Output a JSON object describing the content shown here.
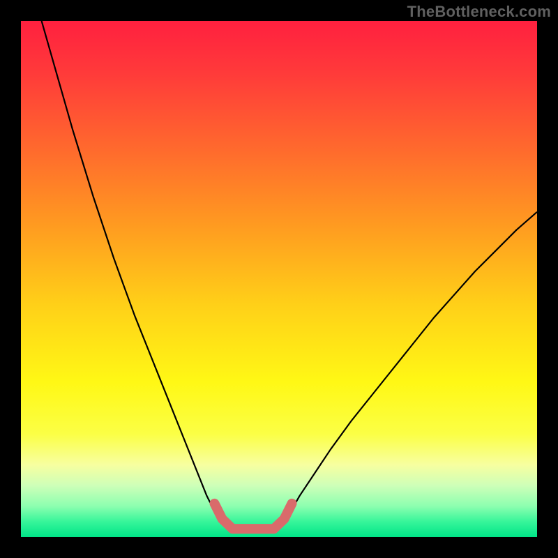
{
  "watermark": "TheBottleneck.com",
  "chart_data": {
    "type": "line",
    "title": "",
    "xlabel": "",
    "ylabel": "",
    "xlim": [
      0,
      100
    ],
    "ylim": [
      0,
      100
    ],
    "grid": false,
    "legend": false,
    "background_gradient": {
      "stops": [
        {
          "offset": 0.0,
          "color": "#ff203f"
        },
        {
          "offset": 0.1,
          "color": "#ff3a3a"
        },
        {
          "offset": 0.25,
          "color": "#ff6a2d"
        },
        {
          "offset": 0.4,
          "color": "#ff9c20"
        },
        {
          "offset": 0.55,
          "color": "#ffd018"
        },
        {
          "offset": 0.7,
          "color": "#fff815"
        },
        {
          "offset": 0.8,
          "color": "#fbff45"
        },
        {
          "offset": 0.86,
          "color": "#f7ffa0"
        },
        {
          "offset": 0.9,
          "color": "#ceffb8"
        },
        {
          "offset": 0.94,
          "color": "#8dffb0"
        },
        {
          "offset": 0.97,
          "color": "#37f59a"
        },
        {
          "offset": 1.0,
          "color": "#00e588"
        }
      ]
    },
    "series": [
      {
        "name": "curve-left",
        "stroke": "#000000",
        "stroke_width": 2.2,
        "points": [
          {
            "x": 4.0,
            "y": 100.0
          },
          {
            "x": 6.0,
            "y": 93.0
          },
          {
            "x": 8.0,
            "y": 86.0
          },
          {
            "x": 10.0,
            "y": 79.0
          },
          {
            "x": 12.0,
            "y": 72.5
          },
          {
            "x": 14.0,
            "y": 66.0
          },
          {
            "x": 16.0,
            "y": 60.0
          },
          {
            "x": 18.0,
            "y": 54.0
          },
          {
            "x": 20.0,
            "y": 48.5
          },
          {
            "x": 22.0,
            "y": 43.0
          },
          {
            "x": 24.0,
            "y": 38.0
          },
          {
            "x": 26.0,
            "y": 33.0
          },
          {
            "x": 28.0,
            "y": 28.0
          },
          {
            "x": 30.0,
            "y": 23.0
          },
          {
            "x": 32.0,
            "y": 18.0
          },
          {
            "x": 34.0,
            "y": 13.0
          },
          {
            "x": 36.0,
            "y": 8.0
          },
          {
            "x": 38.0,
            "y": 4.0
          },
          {
            "x": 40.0,
            "y": 1.6
          }
        ]
      },
      {
        "name": "curve-right",
        "stroke": "#000000",
        "stroke_width": 2.2,
        "points": [
          {
            "x": 50.0,
            "y": 1.6
          },
          {
            "x": 52.0,
            "y": 4.5
          },
          {
            "x": 54.0,
            "y": 8.0
          },
          {
            "x": 56.0,
            "y": 11.0
          },
          {
            "x": 58.0,
            "y": 14.0
          },
          {
            "x": 60.0,
            "y": 17.0
          },
          {
            "x": 64.0,
            "y": 22.5
          },
          {
            "x": 68.0,
            "y": 27.5
          },
          {
            "x": 72.0,
            "y": 32.5
          },
          {
            "x": 76.0,
            "y": 37.5
          },
          {
            "x": 80.0,
            "y": 42.5
          },
          {
            "x": 84.0,
            "y": 47.0
          },
          {
            "x": 88.0,
            "y": 51.5
          },
          {
            "x": 92.0,
            "y": 55.5
          },
          {
            "x": 96.0,
            "y": 59.5
          },
          {
            "x": 100.0,
            "y": 63.0
          }
        ]
      },
      {
        "name": "highlight-bottom",
        "stroke": "#d96b6b",
        "stroke_width": 14,
        "linecap": "round",
        "points": [
          {
            "x": 37.5,
            "y": 6.5
          },
          {
            "x": 39.0,
            "y": 3.5
          },
          {
            "x": 41.0,
            "y": 1.6
          },
          {
            "x": 45.0,
            "y": 1.6
          },
          {
            "x": 49.0,
            "y": 1.6
          },
          {
            "x": 51.0,
            "y": 3.5
          },
          {
            "x": 52.5,
            "y": 6.5
          }
        ]
      }
    ]
  }
}
